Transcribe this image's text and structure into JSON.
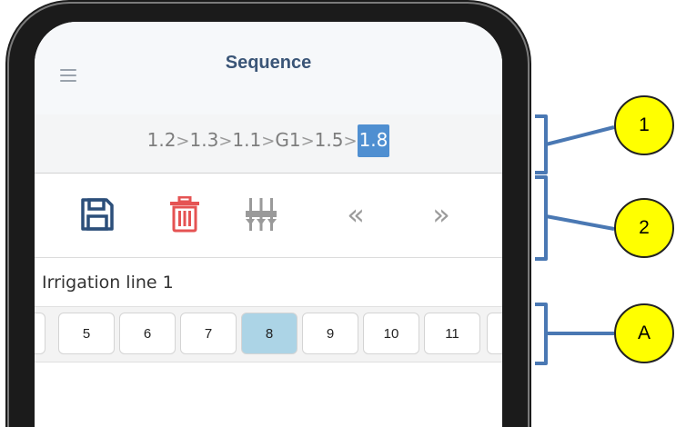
{
  "header": {
    "title": "Sequence",
    "menu_icon": "hamburger-menu-icon"
  },
  "sequence": {
    "items": [
      "1.2",
      "1.3",
      "1.1",
      "G1",
      "1.5"
    ],
    "active": "1.8",
    "separator": ">"
  },
  "toolbar": {
    "save_icon": "save-icon",
    "delete_icon": "trash-icon",
    "mixer_icon": "valves-icon",
    "prev_label": "«",
    "next_label": "»"
  },
  "irrigation": {
    "line_label": "Irrigation line 1",
    "tabs": [
      "5",
      "6",
      "7",
      "8",
      "9",
      "10",
      "11"
    ],
    "selected": "8"
  },
  "callouts": [
    "1",
    "2",
    "A"
  ],
  "colors": {
    "accent": "#4f8fd1",
    "selected_tab": "#acd4e6",
    "callout": "#ffff00",
    "bracket": "#4a78b3",
    "delete": "#e55353",
    "save": "#2c4f7a"
  }
}
